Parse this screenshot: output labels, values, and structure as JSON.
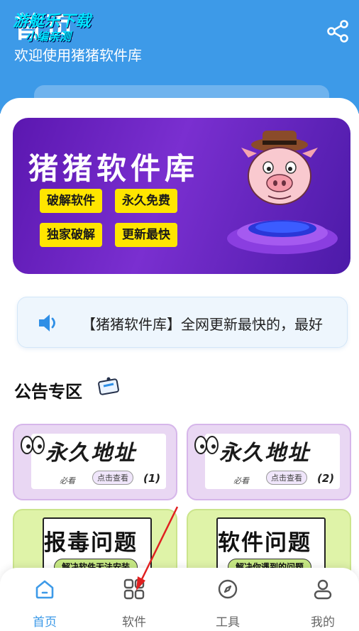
{
  "header": {
    "title": "首页",
    "watermark_line1": "游艇乐下载",
    "watermark_line2": "小编亲测",
    "subtitle": "欢迎使用猪猪软件库",
    "share_icon": "share-icon"
  },
  "banner": {
    "title": "猪猪软件库",
    "chips": [
      "破解软件",
      "永久免费",
      "独家破解",
      "更新最快"
    ]
  },
  "notice": {
    "text": "【猪猪软件库】全网更新最快的，最好"
  },
  "section": {
    "title": "公告专区"
  },
  "cards": [
    {
      "title": "永久地址",
      "small1": "必看",
      "small2": "点击查看",
      "num": "(1)"
    },
    {
      "title": "永久地址",
      "small1": "必看",
      "small2": "点击查看",
      "num": "(2)"
    },
    {
      "title": "报毒问题",
      "pill": "解决软件无法安装"
    },
    {
      "title": "软件问题",
      "pill": "解决你遇到的问题"
    }
  ],
  "tabbar": {
    "items": [
      {
        "label": "首页",
        "icon": "home-icon",
        "active": true
      },
      {
        "label": "软件",
        "icon": "apps-grid-icon",
        "active": false
      },
      {
        "label": "工具",
        "icon": "compass-icon",
        "active": false
      },
      {
        "label": "我的",
        "icon": "user-icon",
        "active": false
      }
    ]
  },
  "colors": {
    "primary": "#3d9ae8",
    "banner": "#5b17b0",
    "chip": "#ffe500",
    "annotation_arrow": "#e02020"
  }
}
